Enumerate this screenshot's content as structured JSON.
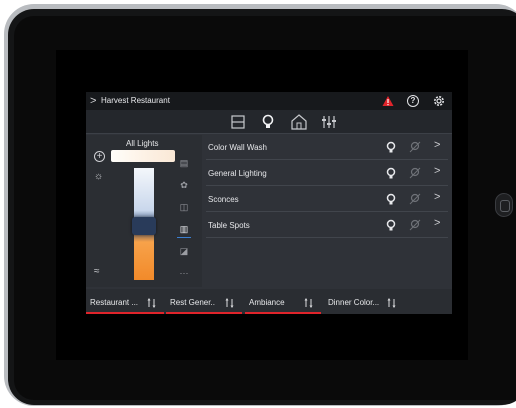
{
  "app": {
    "title": "Harvest Restaurant",
    "title_chevron": ">",
    "accent_color": "#3b7fd0",
    "warning_color": "#e0242b"
  },
  "header_icons": [
    "warning-icon",
    "help-icon",
    "gear-icon"
  ],
  "tabs": [
    {
      "name": "tab-rooms",
      "icon": "layout-icon",
      "active": false
    },
    {
      "name": "tab-lights",
      "icon": "lightbulb-icon",
      "active": true
    },
    {
      "name": "tab-home",
      "icon": "home-icon",
      "active": false
    },
    {
      "name": "tab-adjust",
      "icon": "sliders-icon",
      "active": false
    }
  ],
  "left_panel": {
    "label": "All Lights",
    "add_icon": "+",
    "more_icon": "···"
  },
  "lights": [
    {
      "label": "Color Wall Wash",
      "chevron": ">"
    },
    {
      "label": "General Lighting",
      "chevron": ">"
    },
    {
      "label": "Sconces",
      "chevron": ">"
    },
    {
      "label": "Table Spots",
      "chevron": ">"
    }
  ],
  "scenes": [
    {
      "label": "Restaurant ...",
      "active": true
    },
    {
      "label": "Rest Gener..",
      "active": true
    },
    {
      "label": "Ambiance",
      "active": true
    },
    {
      "label": "Dinner Color...",
      "active": false
    }
  ]
}
